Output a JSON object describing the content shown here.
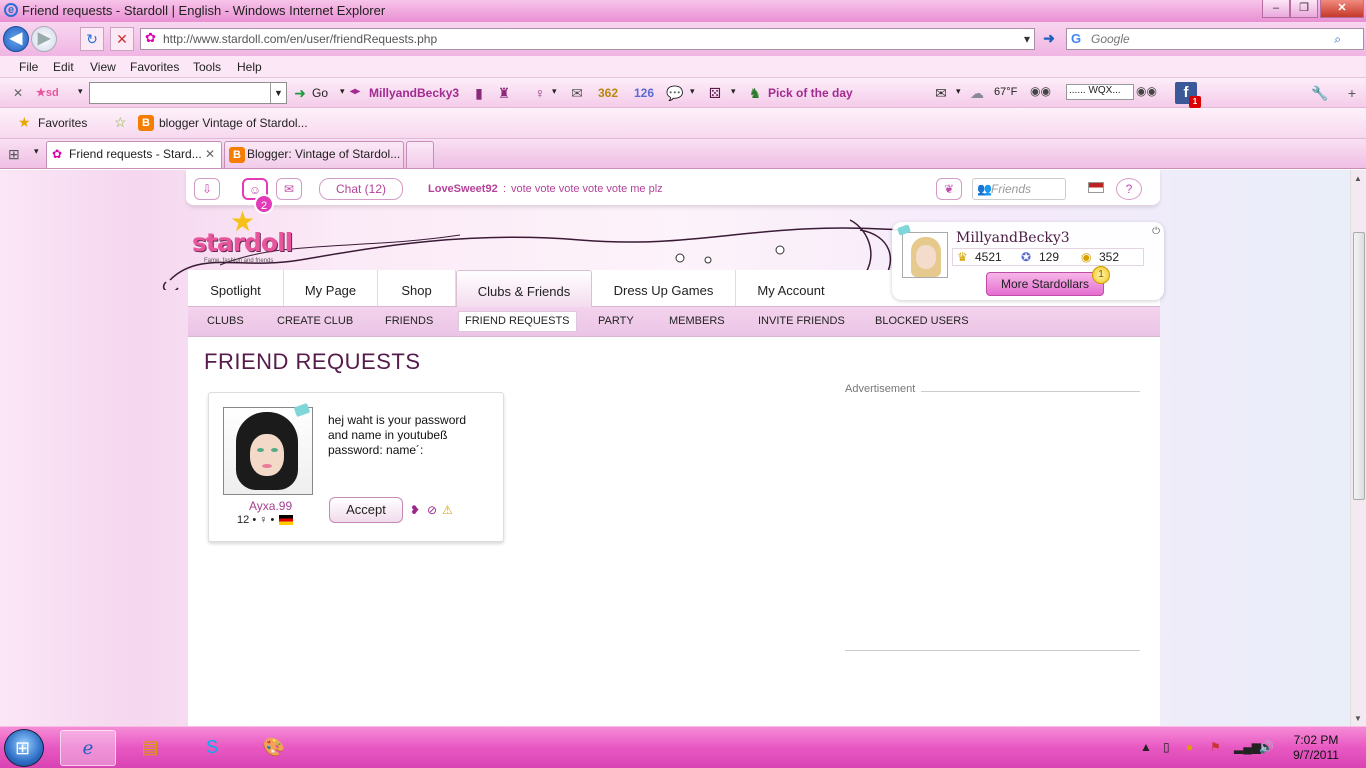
{
  "window": {
    "title": "Friend requests - Stardoll | English - Windows Internet Explorer",
    "url": "http://www.stardoll.com/en/user/friendRequests.php",
    "search_placeholder": "Google"
  },
  "menu": [
    "File",
    "Edit",
    "View",
    "Favorites",
    "Tools",
    "Help"
  ],
  "stardoll_toolbar": {
    "go": "Go",
    "username": "MillyandBecky3",
    "count_a": "362",
    "count_b": "126",
    "pick": "Pick of the day",
    "temp": "67°F",
    "player": "...... WQX...",
    "fb_badge": "1"
  },
  "favorites": {
    "label": "Favorites",
    "item": "blogger Vintage of Stardol..."
  },
  "tabs": [
    {
      "label": "Friend requests - Stard..."
    },
    {
      "label": "Blogger: Vintage of Stardol..."
    }
  ],
  "topbar": {
    "notif_count": "2",
    "chat": "Chat (12)",
    "ticker_user": "LoveSweet92",
    "ticker_msg": "vote vote vote vote vote me plz",
    "friends_placeholder": "Friends"
  },
  "logo": {
    "text": "stardoll",
    "tagline": "Fame, fashion and friends"
  },
  "nav": [
    "Spotlight",
    "My Page",
    "Shop",
    "Clubs & Friends",
    "Dress Up Games",
    "My Account"
  ],
  "subnav": [
    "CLUBS",
    "CREATE CLUB",
    "FRIENDS",
    "FRIEND REQUESTS",
    "PARTY",
    "MEMBERS",
    "INVITE FRIENDS",
    "BLOCKED USERS"
  ],
  "profile": {
    "name": "MillyandBecky3",
    "fame": "4521",
    "starpoints": "129",
    "stardollars": "352",
    "more_btn": "More Stardollars",
    "coin_badge": "1"
  },
  "page": {
    "title": "FRIEND REQUESTS",
    "ad_label": "Advertisement"
  },
  "request": {
    "name": "Ayxa.99",
    "age": "12",
    "message": "hej waht is your password and name in youtubeß password: name´:",
    "accept": "Accept"
  },
  "taskbar": {
    "time": "7:02 PM",
    "date": "9/7/2011"
  },
  "colors": {
    "accent": "#e858c2",
    "title_text": "#561b4a",
    "link_pink": "#a53f8e"
  }
}
